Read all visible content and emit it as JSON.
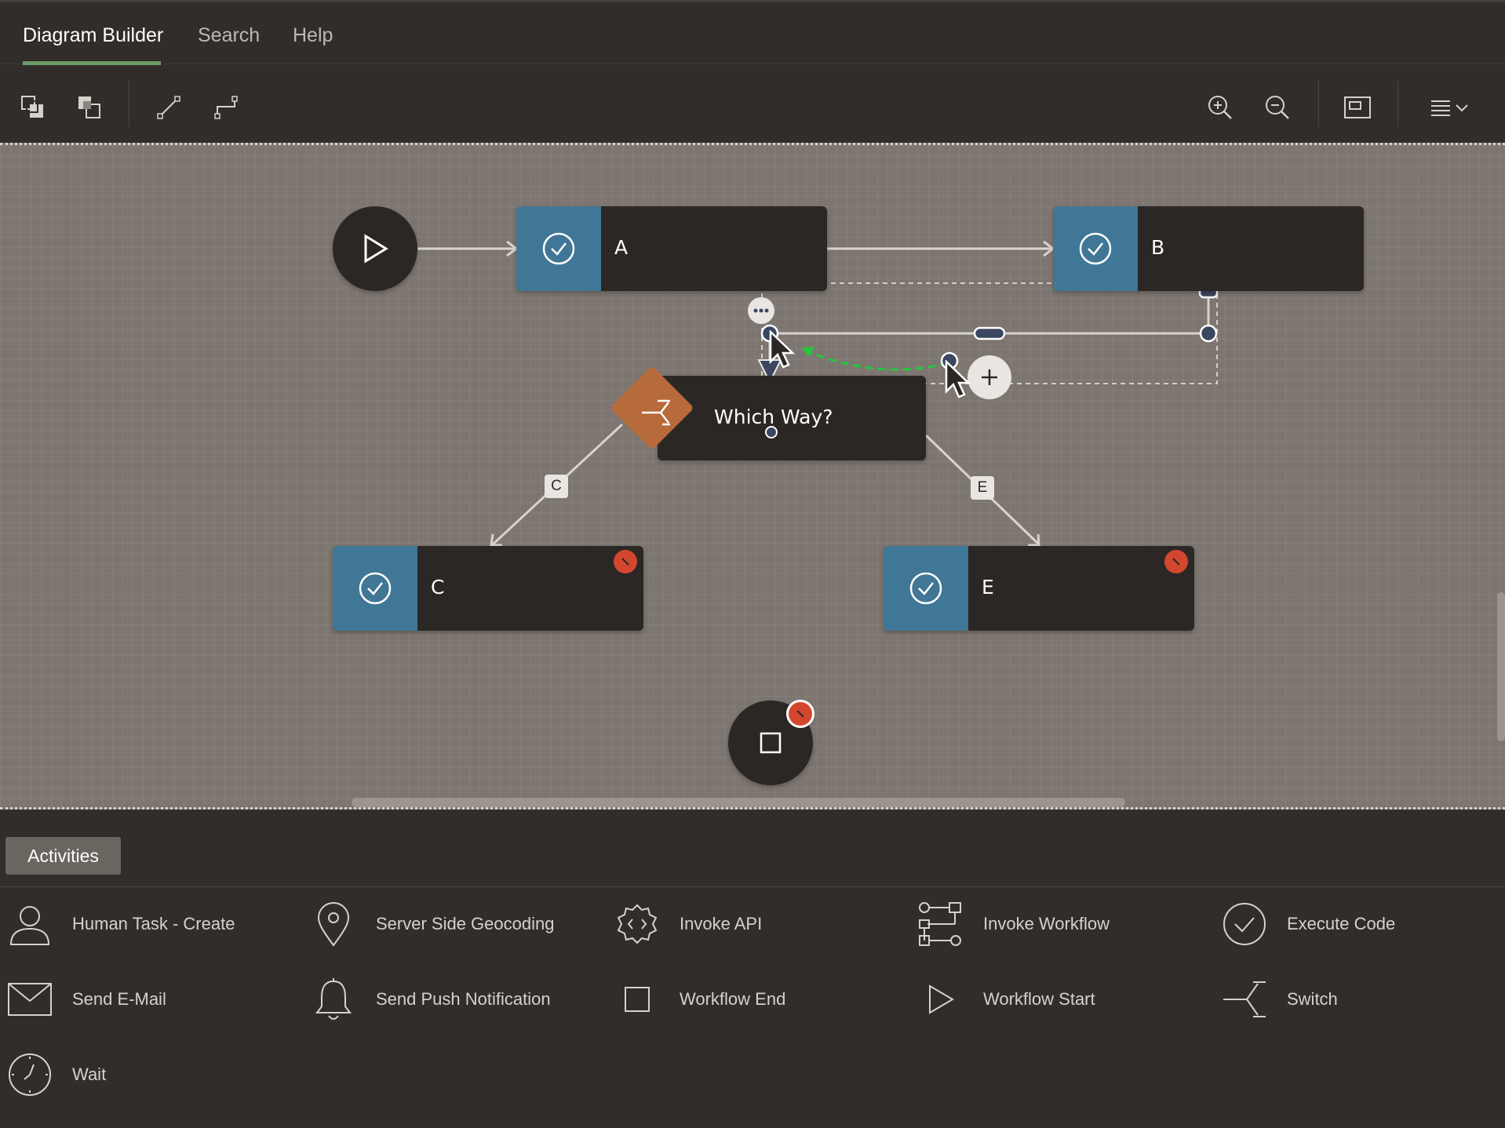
{
  "tabs": [
    {
      "label": "Diagram Builder",
      "active": true
    },
    {
      "label": "Search",
      "active": false
    },
    {
      "label": "Help",
      "active": false
    }
  ],
  "toolbar": {
    "left_buttons": [
      "arrange-back-icon",
      "arrange-front-icon",
      "straight-connector-icon",
      "elbow-connector-icon"
    ],
    "right_buttons": [
      "zoom-in-icon",
      "zoom-out-icon",
      "fit-to-screen-icon",
      "menu-icon"
    ]
  },
  "diagram": {
    "nodes": {
      "a": {
        "label": "A",
        "type": "execute-code"
      },
      "b": {
        "label": "B",
        "type": "execute-code"
      },
      "switch": {
        "label": "Which Way?",
        "type": "switch"
      },
      "c": {
        "label": "C",
        "type": "execute-code",
        "error": true
      },
      "e": {
        "label": "E",
        "type": "execute-code",
        "error": true
      },
      "start": {
        "type": "workflow-start"
      },
      "end": {
        "type": "workflow-end",
        "error": true
      }
    },
    "edge_labels": {
      "c": "C",
      "e": "E"
    }
  },
  "colors": {
    "canvas": "#7d7670",
    "node": "#2b2725",
    "activity_accent": "#417796",
    "switch_accent": "#b76a3a",
    "error": "#d4472f",
    "tab_underline": "#6d9c68",
    "drag_line": "#22c83a"
  },
  "panel": {
    "tab_label": "Activities",
    "activities": [
      {
        "label": "Human Task - Create",
        "icon": "person-icon"
      },
      {
        "label": "Server Side Geocoding",
        "icon": "map-pin-icon"
      },
      {
        "label": "Invoke API",
        "icon": "gear-code-icon"
      },
      {
        "label": "Invoke Workflow",
        "icon": "workflow-icon"
      },
      {
        "label": "Execute Code",
        "icon": "check-circle-icon"
      },
      {
        "label": "Send E-Mail",
        "icon": "envelope-icon"
      },
      {
        "label": "Send Push Notification",
        "icon": "bell-icon"
      },
      {
        "label": "Workflow End",
        "icon": "square-icon"
      },
      {
        "label": "Workflow Start",
        "icon": "play-icon"
      },
      {
        "label": "Switch",
        "icon": "switch-icon"
      },
      {
        "label": "Wait",
        "icon": "clock-icon"
      }
    ]
  }
}
